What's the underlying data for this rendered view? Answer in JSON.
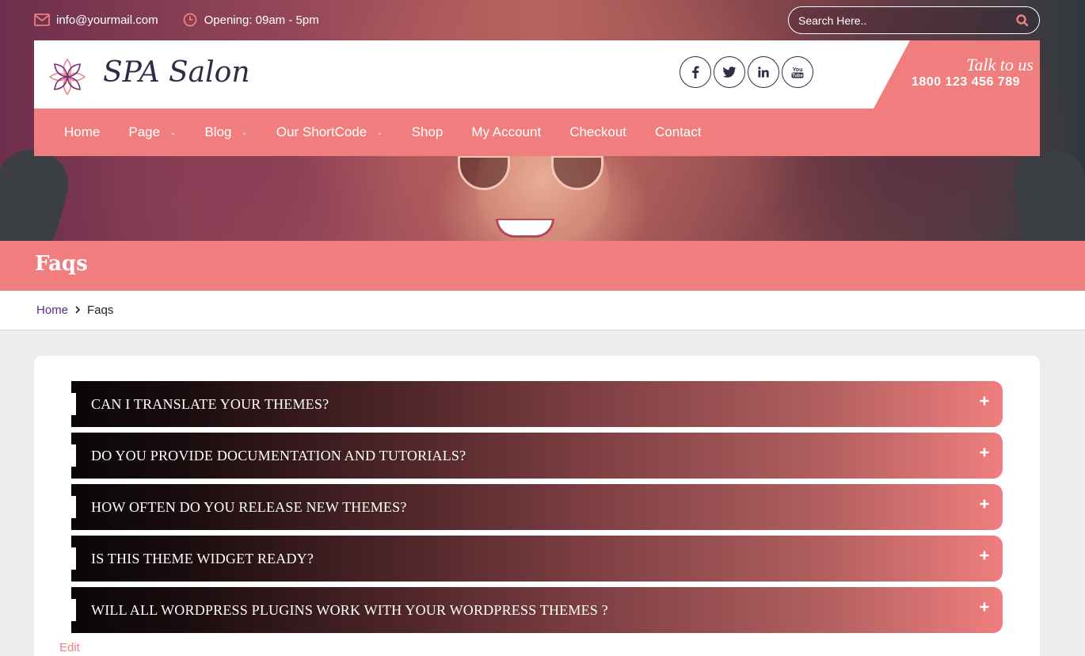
{
  "topbar": {
    "email": "info@yourmail.com",
    "hours": "Opening: 09am - 5pm",
    "search_placeholder": "Search Here.."
  },
  "header": {
    "brand": "SPA Salon",
    "talk_label": "Talk to us",
    "phone": "1800 123 456 789",
    "socials": [
      "f",
      "twitter",
      "in",
      "You Tube"
    ]
  },
  "nav": {
    "items": [
      "Home",
      "Page",
      "Blog",
      "Our ShortCode",
      "Shop",
      "My Account",
      "Checkout",
      "Contact"
    ]
  },
  "page": {
    "title": "Faqs",
    "breadcrumb_home": "Home",
    "breadcrumb_current": "Faqs"
  },
  "faqs": [
    "Can I translate your themes?",
    "Do you provide documentation and tutorials?",
    "How often do you release new themes?",
    "Is this theme widget ready?",
    "Will all wordpress plugins work with your wordpress themes ?"
  ],
  "edit_label": "Edit",
  "colors": {
    "accent": "#f07e7e",
    "brand_text": "#2d2d45",
    "breadcrumb_link": "#5b2b85"
  }
}
